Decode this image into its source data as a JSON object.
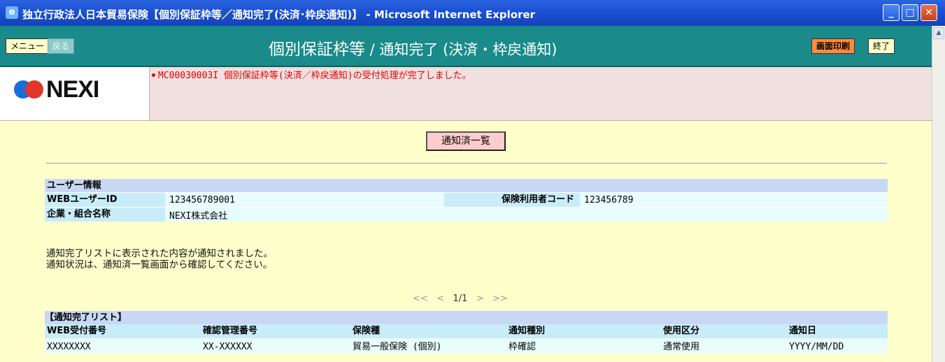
{
  "window": {
    "title": "独立行政法人日本貿易保険【個別保証枠等／通知完了(決済･枠戻通知)】 - Microsoft Internet Explorer",
    "minimize_glyph": "_",
    "maximize_glyph": "□",
    "close_glyph": "✕"
  },
  "header": {
    "menu_label": "メニュー",
    "back_label": "戻る",
    "title_main": "個別保証枠等",
    "title_sub": " / 通知完了 (決済・枠戻通知)",
    "print_label": "画面印刷",
    "end_label": "終了"
  },
  "logo": {
    "text": "NEXI"
  },
  "message": "MC00030003I 個別保証枠等(決済／枠戻通知)の受付処理が完了しました。",
  "main": {
    "list_button_label": "通知済一覧",
    "user_info": {
      "section_title": "ユーザー情報",
      "web_user_id_label": "WEBユーザーID",
      "web_user_id_value": "123456789001",
      "insurance_user_code_label": "保険利用者コード",
      "insurance_user_code_value": "123456789",
      "company_label": "企業・組合名称",
      "company_value": "NEXI株式会社"
    },
    "info_text": [
      "通知完了リストに表示された内容が通知されました。",
      "通知状況は、通知済一覧画面から確認してください。"
    ],
    "pager": {
      "first": "<<",
      "prev": "<",
      "current": "1/1",
      "next": ">",
      "last": ">>"
    },
    "list": {
      "title": "【通知完了リスト】",
      "columns": [
        "WEB受付番号",
        "確認管理番号",
        "保険種",
        "通知種別",
        "使用区分",
        "通知日"
      ],
      "rows": [
        [
          "XXXXXXXX",
          "XX-XXXXXX",
          "貿易一般保険 (個別)",
          "枠確認",
          "通常使用",
          "YYYY/MM/DD"
        ]
      ]
    }
  },
  "colors": {
    "titlebar": "#1a4fd0",
    "header": "#1a8a8a",
    "message_bg": "#f0e0e0",
    "page_bg": "#ffffcc",
    "message_text": "#e60000"
  }
}
